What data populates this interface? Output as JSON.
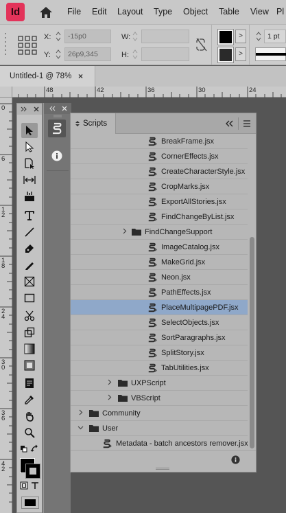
{
  "app": {
    "logo_text": "Id"
  },
  "menu": {
    "items": [
      "File",
      "Edit",
      "Layout",
      "Type",
      "Object",
      "Table",
      "View",
      "Pl"
    ]
  },
  "control_bar": {
    "x_label": "X:",
    "y_label": "Y:",
    "w_label": "W:",
    "h_label": "H:",
    "x_value": "-15p0",
    "y_value": "26p9,345",
    "w_value": "",
    "h_value": "",
    "stroke_weight": "1 pt"
  },
  "document": {
    "tab_title": "Untitled-1 @ 78%",
    "close_glyph": "×"
  },
  "ruler": {
    "horizontal": [
      "48",
      "42",
      "36",
      "30",
      "24"
    ],
    "vertical": [
      "0",
      "6",
      "1\n2",
      "1\n8",
      "2\n4",
      "3\n0",
      "3\n6",
      "4\n2"
    ]
  },
  "scripts_panel": {
    "tab_label": "Scripts",
    "rows": [
      {
        "label": "BreakFrame.jsx",
        "kind": "script",
        "indent": 3
      },
      {
        "label": "CornerEffects.jsx",
        "kind": "script",
        "indent": 3
      },
      {
        "label": "CreateCharacterStyle.jsx",
        "kind": "script",
        "indent": 3
      },
      {
        "label": "CropMarks.jsx",
        "kind": "script",
        "indent": 3
      },
      {
        "label": "ExportAllStories.jsx",
        "kind": "script",
        "indent": 3
      },
      {
        "label": "FindChangeByList.jsx",
        "kind": "script",
        "indent": 3
      },
      {
        "label": "FindChangeSupport",
        "kind": "folder",
        "indent": 3,
        "expandable": true
      },
      {
        "label": "ImageCatalog.jsx",
        "kind": "script",
        "indent": 3
      },
      {
        "label": "MakeGrid.jsx",
        "kind": "script",
        "indent": 3
      },
      {
        "label": "Neon.jsx",
        "kind": "script",
        "indent": 3
      },
      {
        "label": "PathEffects.jsx",
        "kind": "script",
        "indent": 3
      },
      {
        "label": "PlaceMultipagePDF.jsx",
        "kind": "script",
        "indent": 3,
        "selected": true
      },
      {
        "label": "SelectObjects.jsx",
        "kind": "script",
        "indent": 3
      },
      {
        "label": "SortParagraphs.jsx",
        "kind": "script",
        "indent": 3
      },
      {
        "label": "SplitStory.jsx",
        "kind": "script",
        "indent": 3
      },
      {
        "label": "TabUtilities.jsx",
        "kind": "script",
        "indent": 3
      },
      {
        "label": "UXPScript",
        "kind": "folder",
        "indent": 2,
        "expandable": true
      },
      {
        "label": "VBScript",
        "kind": "folder",
        "indent": 2,
        "expandable": true
      },
      {
        "label": "Community",
        "kind": "folder",
        "indent": 0,
        "expandable": true
      },
      {
        "label": "User",
        "kind": "folder",
        "indent": 0,
        "expanded": true
      },
      {
        "label": "Metadata - batch ancestors remover.jsx",
        "kind": "script",
        "indent": 1
      }
    ]
  },
  "colors": {
    "selection": "#8fa8c9",
    "accent_logo": "#e3335a"
  }
}
